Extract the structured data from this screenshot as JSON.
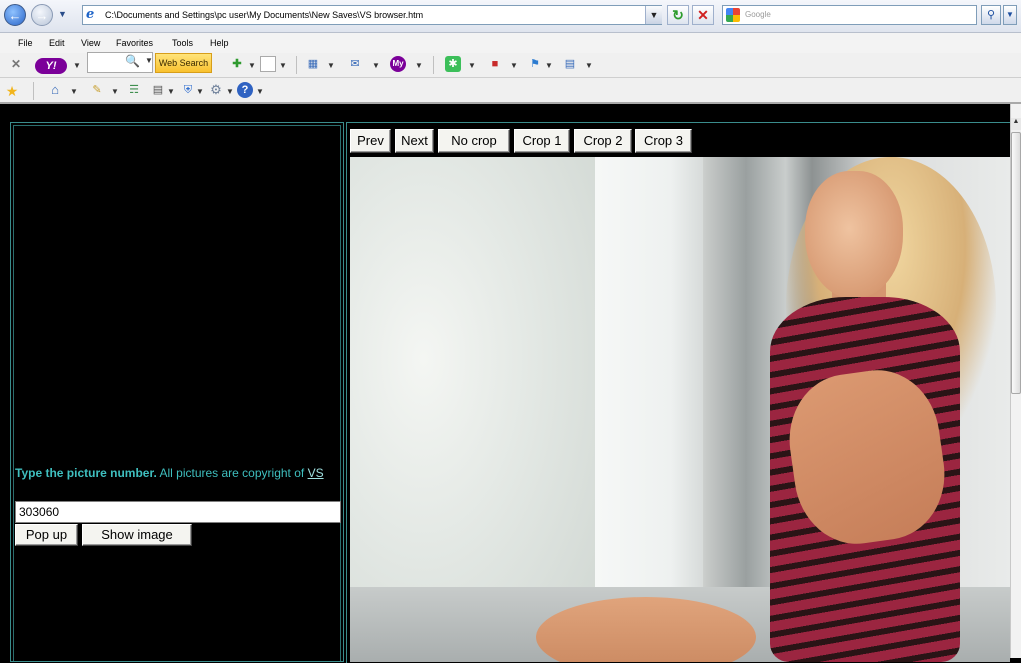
{
  "browser": {
    "address": "C:\\Documents and Settings\\pc user\\My Documents\\New Saves\\VS browser.htm",
    "search_placeholder": "Google",
    "menu": [
      "File",
      "Edit",
      "View",
      "Favorites",
      "Tools",
      "Help"
    ],
    "yahoo_logo": "Y!",
    "yahoo_search_button": "Web Search",
    "my_yahoo_label": "My"
  },
  "left_panel": {
    "instruction_bold": "Type the picture number.",
    "instruction_rest": " All pictures are copyright of ",
    "copyright_link": "VS",
    "picture_number": "303060",
    "popup_label": "Pop up",
    "show_image_label": "Show image"
  },
  "right_panel": {
    "prev_label": "Prev",
    "next_label": "Next",
    "no_crop_label": "No crop",
    "crop1_label": "Crop 1",
    "crop2_label": "Crop 2",
    "crop3_label": "Crop 3"
  }
}
